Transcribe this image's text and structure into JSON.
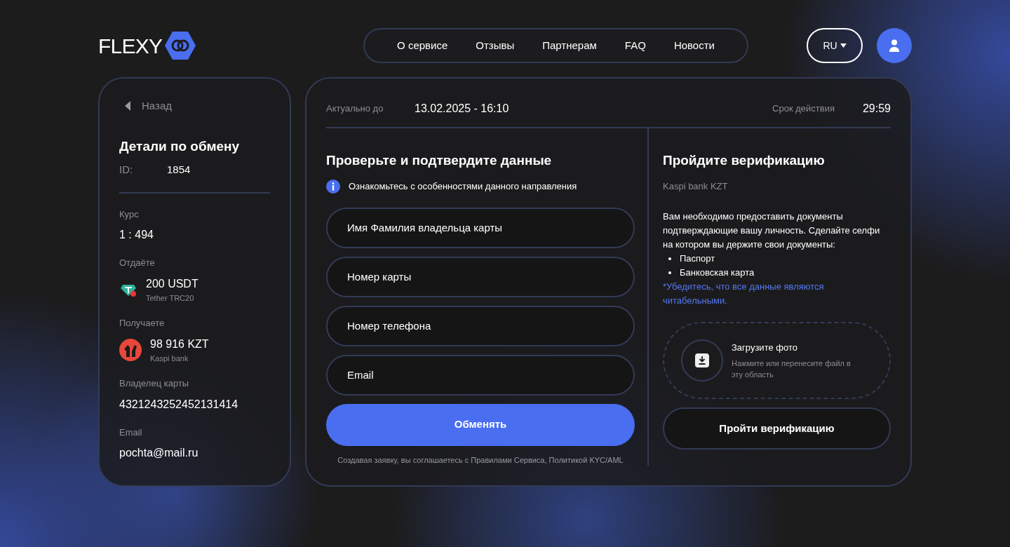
{
  "header": {
    "logo": "FLEXY",
    "nav": [
      "О сервисе",
      "Отзывы",
      "Партнерам",
      "FAQ",
      "Новости"
    ],
    "language": "RU"
  },
  "details": {
    "back": "Назад",
    "title": "Детали по обмену",
    "id_label": "ID:",
    "id_value": "1854",
    "items": [
      {
        "kind": "plain",
        "label": "Курс",
        "value": "1 : 494"
      },
      {
        "kind": "crypto",
        "label": "Отдаёте",
        "value": "200 USDT",
        "sub": "Tether TRC20"
      },
      {
        "kind": "bank",
        "label": "Получаете",
        "value": "98 916 KZT",
        "sub": "Kaspi bank"
      },
      {
        "kind": "plain",
        "label": "Владелец карты",
        "value": "4321243252452131414"
      },
      {
        "kind": "plain",
        "label": "Email",
        "value": "pochta@mail.ru"
      }
    ]
  },
  "order": {
    "valid_label": "Актуально до",
    "valid_value": "13.02.2025 - 16:10",
    "expiry_label": "Срок действия",
    "expiry_value": "29:59",
    "form": {
      "title": "Проверьте и подтвердите данные",
      "info": "Ознакомьтесь с особенностями данного направления",
      "fields": [
        {
          "placeholder": "Имя Фамилия владельца карты"
        },
        {
          "placeholder": "Номер карты"
        },
        {
          "placeholder": "Номер телефона"
        },
        {
          "placeholder": "Email"
        }
      ],
      "submit": "Обменять",
      "terms": "Создавая заявку, вы соглашаетесь с Правилами Сервиса, Политикой KYC/AML"
    },
    "verification": {
      "title": "Пройдите верификацию",
      "subtitle": "Kaspi bank KZT",
      "text": "Вам необходимо предоставить документы подтверждающие вашу личность. Сделайте селфи на котором вы держите свои документы:",
      "documents": [
        "Паспорт",
        "Банковская карта"
      ],
      "note": "*Убедитесь, что все данные являются читабельными.",
      "upload_title": "Загрузите фото",
      "upload_hint": "Нажмите или перенесите файл в эту область",
      "button": "Пройти верификацию"
    }
  }
}
